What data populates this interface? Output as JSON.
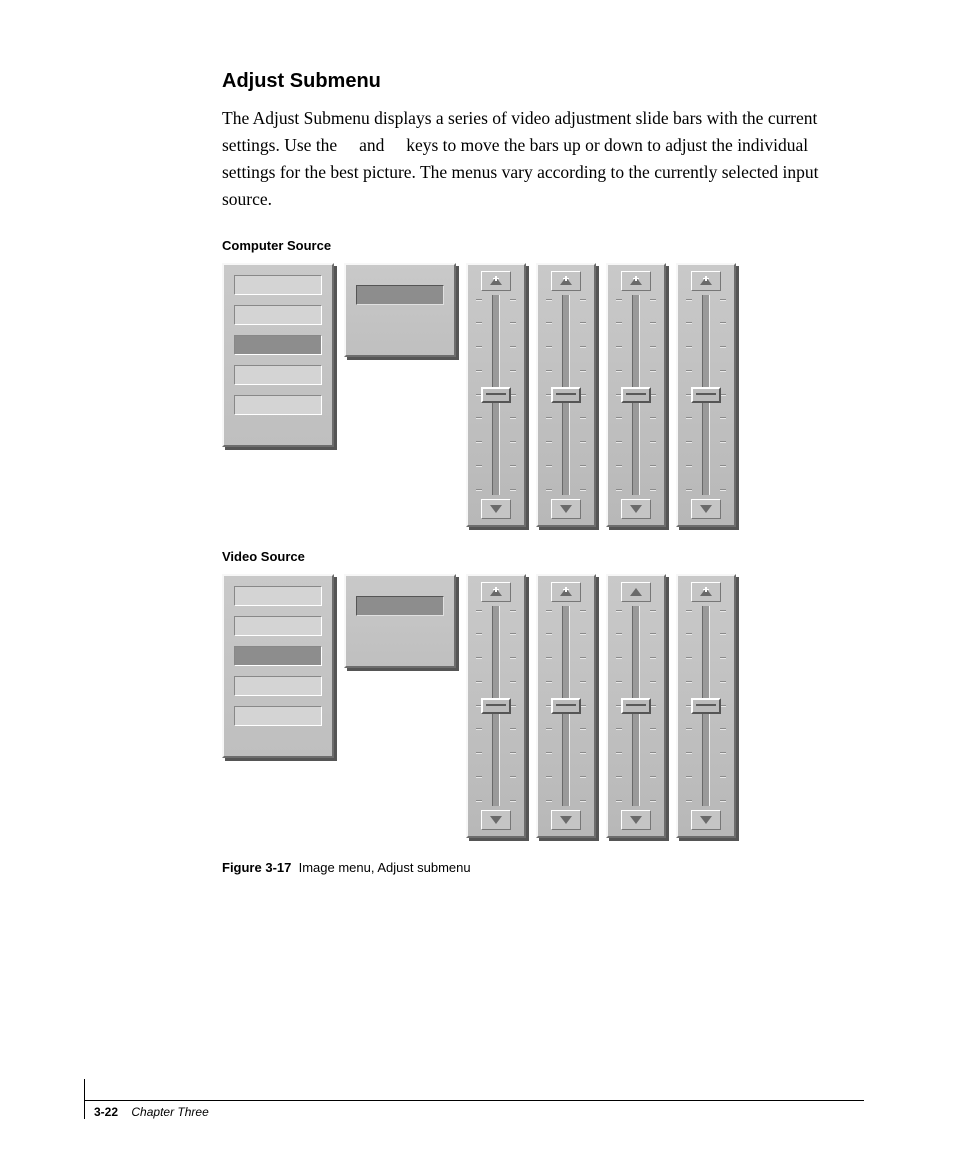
{
  "heading": "Adjust Submenu",
  "paragraph": "The Adjust Submenu displays a series of video adjustment slide bars with the current settings. Use the     and     keys to move the bars up or down to adjust the individual settings for the best picture. The menus vary according to the currently selected input source.",
  "sources": [
    {
      "label": "Computer Source",
      "sliders": 4,
      "plus_arrows": [
        true,
        true,
        true,
        true
      ]
    },
    {
      "label": "Video Source",
      "sliders": 4,
      "plus_arrows": [
        true,
        true,
        false,
        true
      ]
    }
  ],
  "figure_caption_bold": "Figure 3-17",
  "figure_caption_rest": "Image menu, Adjust submenu",
  "footer_page": "3-22",
  "footer_chapter": "Chapter Three"
}
